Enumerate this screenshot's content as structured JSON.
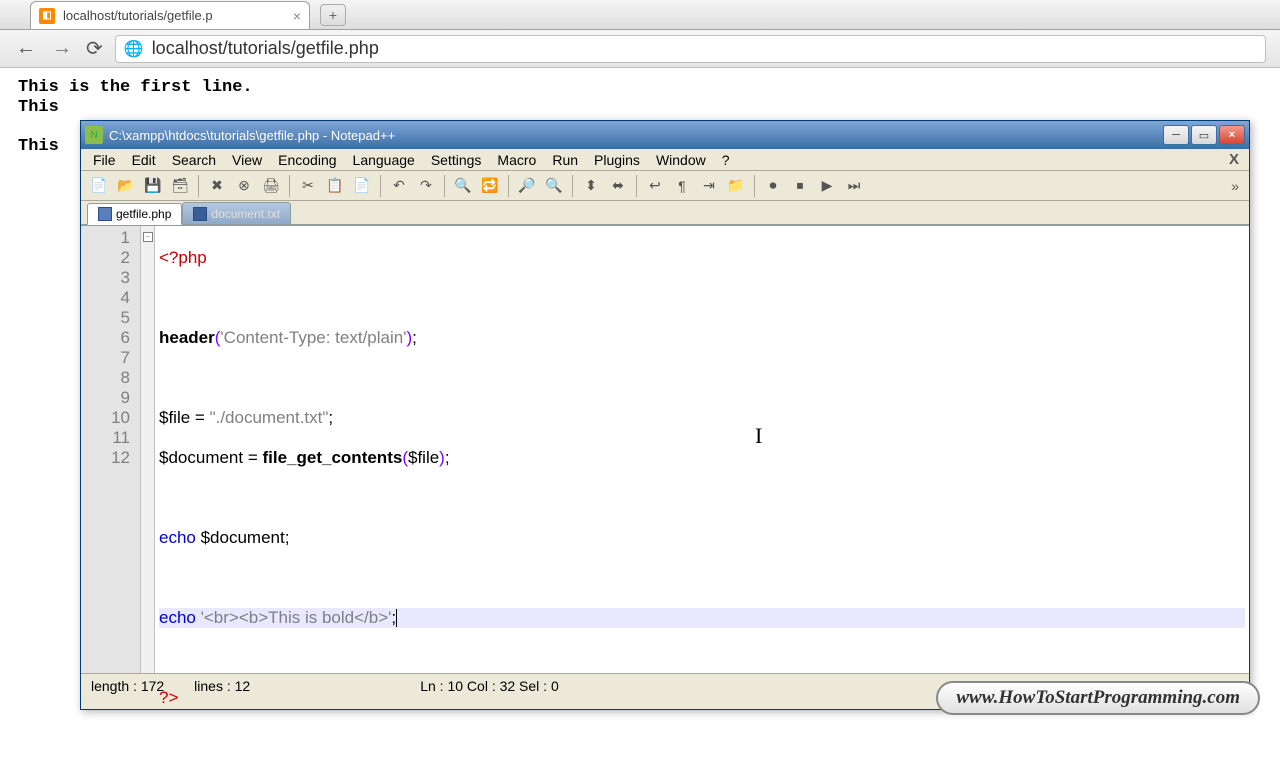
{
  "browser": {
    "tab_title": "localhost/tutorials/getfile.p",
    "url": "localhost/tutorials/getfile.php",
    "page_text": "This is the first line.\nThis\n\nThis"
  },
  "npp": {
    "title": "C:\\xampp\\htdocs\\tutorials\\getfile.php - Notepad++",
    "menus": [
      "File",
      "Edit",
      "Search",
      "View",
      "Encoding",
      "Language",
      "Settings",
      "Macro",
      "Run",
      "Plugins",
      "Window",
      "?"
    ],
    "tabs": [
      {
        "label": "getfile.php",
        "active": true
      },
      {
        "label": "document.txt",
        "active": false
      }
    ],
    "lines": {
      "total": 12,
      "l1_open": "<?php",
      "l3_fn": "header",
      "l3_str": "'Content-Type: text/plain'",
      "l5_var": "$file",
      "l5_eq": " = ",
      "l5_str": "\"./document.txt\"",
      "l6_var": "$document",
      "l6_eq": " = ",
      "l6_fn": "file_get_contents",
      "l6_arg": "$file",
      "l8_echo": "echo",
      "l8_var": " $document",
      "l10_echo": "echo",
      "l10_str": " '<br><b>This is bold</b>'",
      "l12_close": "?>"
    },
    "status": {
      "length": "length : 172",
      "lines": "lines : 12",
      "pos": "Ln : 10    Col : 32    Sel : 0"
    }
  },
  "watermark": "www.HowToStartProgramming.com"
}
